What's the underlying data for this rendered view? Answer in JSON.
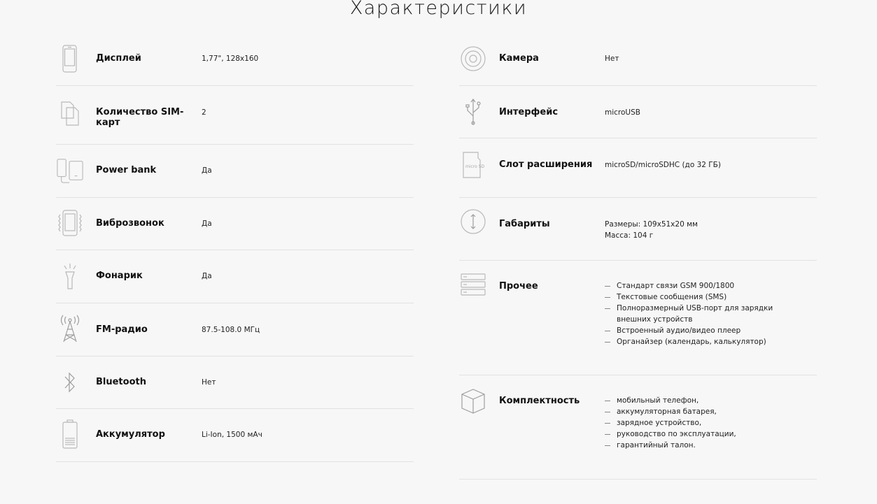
{
  "title": "Характеристики",
  "left": [
    {
      "icon": "display-icon",
      "label": "Дисплей",
      "value": "1,77\", 128x160"
    },
    {
      "icon": "sim-cards-icon",
      "label": "Количество SIM-карт",
      "value": "2"
    },
    {
      "icon": "power-bank-icon",
      "label": "Power bank",
      "value": "Да"
    },
    {
      "icon": "vibration-icon",
      "label": "Виброзвонок",
      "value": "Да"
    },
    {
      "icon": "flashlight-icon",
      "label": "Фонарик",
      "value": "Да"
    },
    {
      "icon": "radio-tower-icon",
      "label": "FM-радио",
      "value": "87.5-108.0 МГц"
    },
    {
      "icon": "bluetooth-icon",
      "label": "Bluetooth",
      "value": "Нет"
    },
    {
      "icon": "battery-icon",
      "label": "Аккумулятор",
      "value": "Li-Ion, 1500 мАч"
    }
  ],
  "right": [
    {
      "icon": "camera-icon",
      "label": "Камера",
      "value": "Нет"
    },
    {
      "icon": "usb-icon",
      "label": "Интерфейс",
      "value": "microUSB"
    },
    {
      "icon": "microsd-card-icon",
      "icon_text": "micro SD",
      "label": "Слот расширения",
      "value": "microSD/microSDHC (до 32 ГБ)"
    },
    {
      "icon": "dimensions-icon",
      "label": "Габариты",
      "value_lines": [
        "Размеры: 109x51x20 мм",
        "Масса: 104 г"
      ]
    },
    {
      "icon": "misc-icon",
      "label": "Прочее",
      "list": [
        "Стандарт связи GSM 900/1800",
        "Текстовые сообщения (SMS)",
        "Полноразмерный USB-порт для зарядки внешних устройств",
        "Встроенный аудио/видео плеер",
        "Органайзер (календарь, калькулятор)"
      ]
    },
    {
      "icon": "package-box-icon",
      "label": "Комплектность",
      "list": [
        "мобильный телефон,",
        "аккумуляторная батарея,",
        "зарядное устройство,",
        "руководство по эксплуатации,",
        "гарантийный талон."
      ]
    }
  ]
}
